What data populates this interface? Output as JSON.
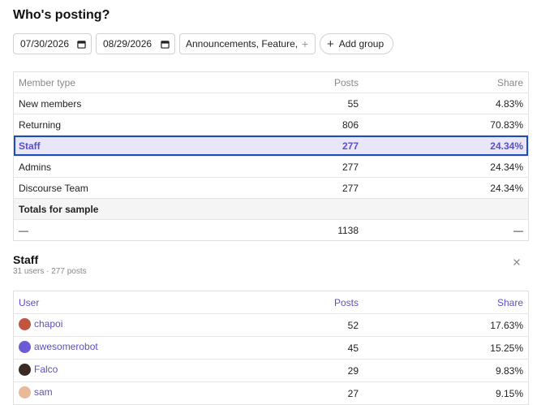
{
  "title": "Who's posting?",
  "filters": {
    "start_date": "07/30/2026",
    "end_date": "08/29/2026",
    "categories": "Announcements, Feature,...",
    "add_group_label": "Add group"
  },
  "summary": {
    "headers": {
      "type": "Member type",
      "posts": "Posts",
      "share": "Share"
    },
    "rows": [
      {
        "type": "New members",
        "posts": "55",
        "share": "4.83%"
      },
      {
        "type": "Returning",
        "posts": "806",
        "share": "70.83%"
      },
      {
        "type": "Staff",
        "posts": "277",
        "share": "24.34%"
      },
      {
        "type": "Admins",
        "posts": "277",
        "share": "24.34%"
      },
      {
        "type": "Discourse Team",
        "posts": "277",
        "share": "24.34%"
      }
    ],
    "totals_label": "Totals for sample",
    "totals": {
      "type": "—",
      "posts": "1138",
      "share": "—"
    }
  },
  "drilldown": {
    "title": "Staff",
    "subtitle": "31 users · 277 posts",
    "headers": {
      "user": "User",
      "posts": "Posts",
      "share": "Share"
    },
    "rows": [
      {
        "user": "chapoi",
        "posts": "52",
        "share": "17.63%",
        "avatar_color": "#c0563d"
      },
      {
        "user": "awesomerobot",
        "posts": "45",
        "share": "15.25%",
        "avatar_color": "#6b5bd6"
      },
      {
        "user": "Falco",
        "posts": "29",
        "share": "9.83%",
        "avatar_color": "#3a2a22"
      },
      {
        "user": "sam",
        "posts": "27",
        "share": "9.15%",
        "avatar_color": "#e9b99a"
      }
    ]
  },
  "colors": {
    "accent": "#5a4fc9",
    "selected_row": "#e8e6f7",
    "selected_border": "#1b4eb8"
  }
}
